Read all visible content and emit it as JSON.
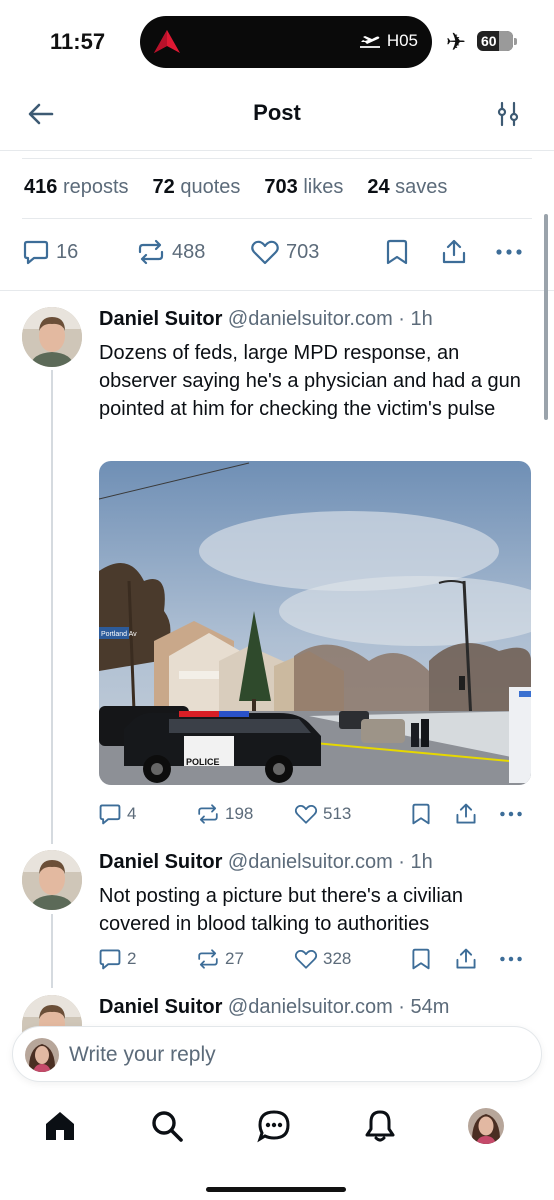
{
  "status_bar": {
    "time": "11:57",
    "flight_label": "H05",
    "battery_level": "60",
    "battery_fraction": 0.6
  },
  "header": {
    "title": "Post"
  },
  "stats": [
    {
      "count": "416",
      "label": "reposts"
    },
    {
      "count": "72",
      "label": "quotes"
    },
    {
      "count": "703",
      "label": "likes"
    },
    {
      "count": "24",
      "label": "saves"
    }
  ],
  "main_actions": {
    "replies": "16",
    "reposts": "488",
    "likes": "703"
  },
  "posts": [
    {
      "name": "Daniel Suitor",
      "handle_time": "@danielsuitor.com · 1h",
      "text": "Dozens of feds, large MPD response, an observer saying he's a physician and had a gun pointed at him for checking the victim's pulse",
      "replies": "4",
      "reposts": "198",
      "likes": "513",
      "image_text": {
        "car_label": "POLICE",
        "street_sign": "Portland Av"
      }
    },
    {
      "name": "Daniel Suitor",
      "handle_time": "@danielsuitor.com · 1h",
      "text": "Not posting a picture but there's a civilian covered in blood talking to authorities",
      "replies": "2",
      "reposts": "27",
      "likes": "328"
    },
    {
      "name": "Daniel Suitor",
      "handle_time": "@danielsuitor.com · 54m"
    }
  ],
  "composer": {
    "placeholder": "Write your reply"
  },
  "icons": {
    "back": "arrow-left-icon",
    "filter": "sliders-icon",
    "reply": "speech-bubble-icon",
    "repost": "repost-arrows-icon",
    "like": "heart-icon",
    "bookmark": "bookmark-icon",
    "share": "share-icon",
    "more": "ellipsis-icon",
    "home": "home-icon",
    "search": "search-icon",
    "chat": "chat-icon",
    "notifications": "bell-icon"
  },
  "colors": {
    "text": "#0b0f14",
    "muted": "#5c6b7a",
    "divider": "#e6e9ec",
    "icon": "#5c6b7a"
  }
}
